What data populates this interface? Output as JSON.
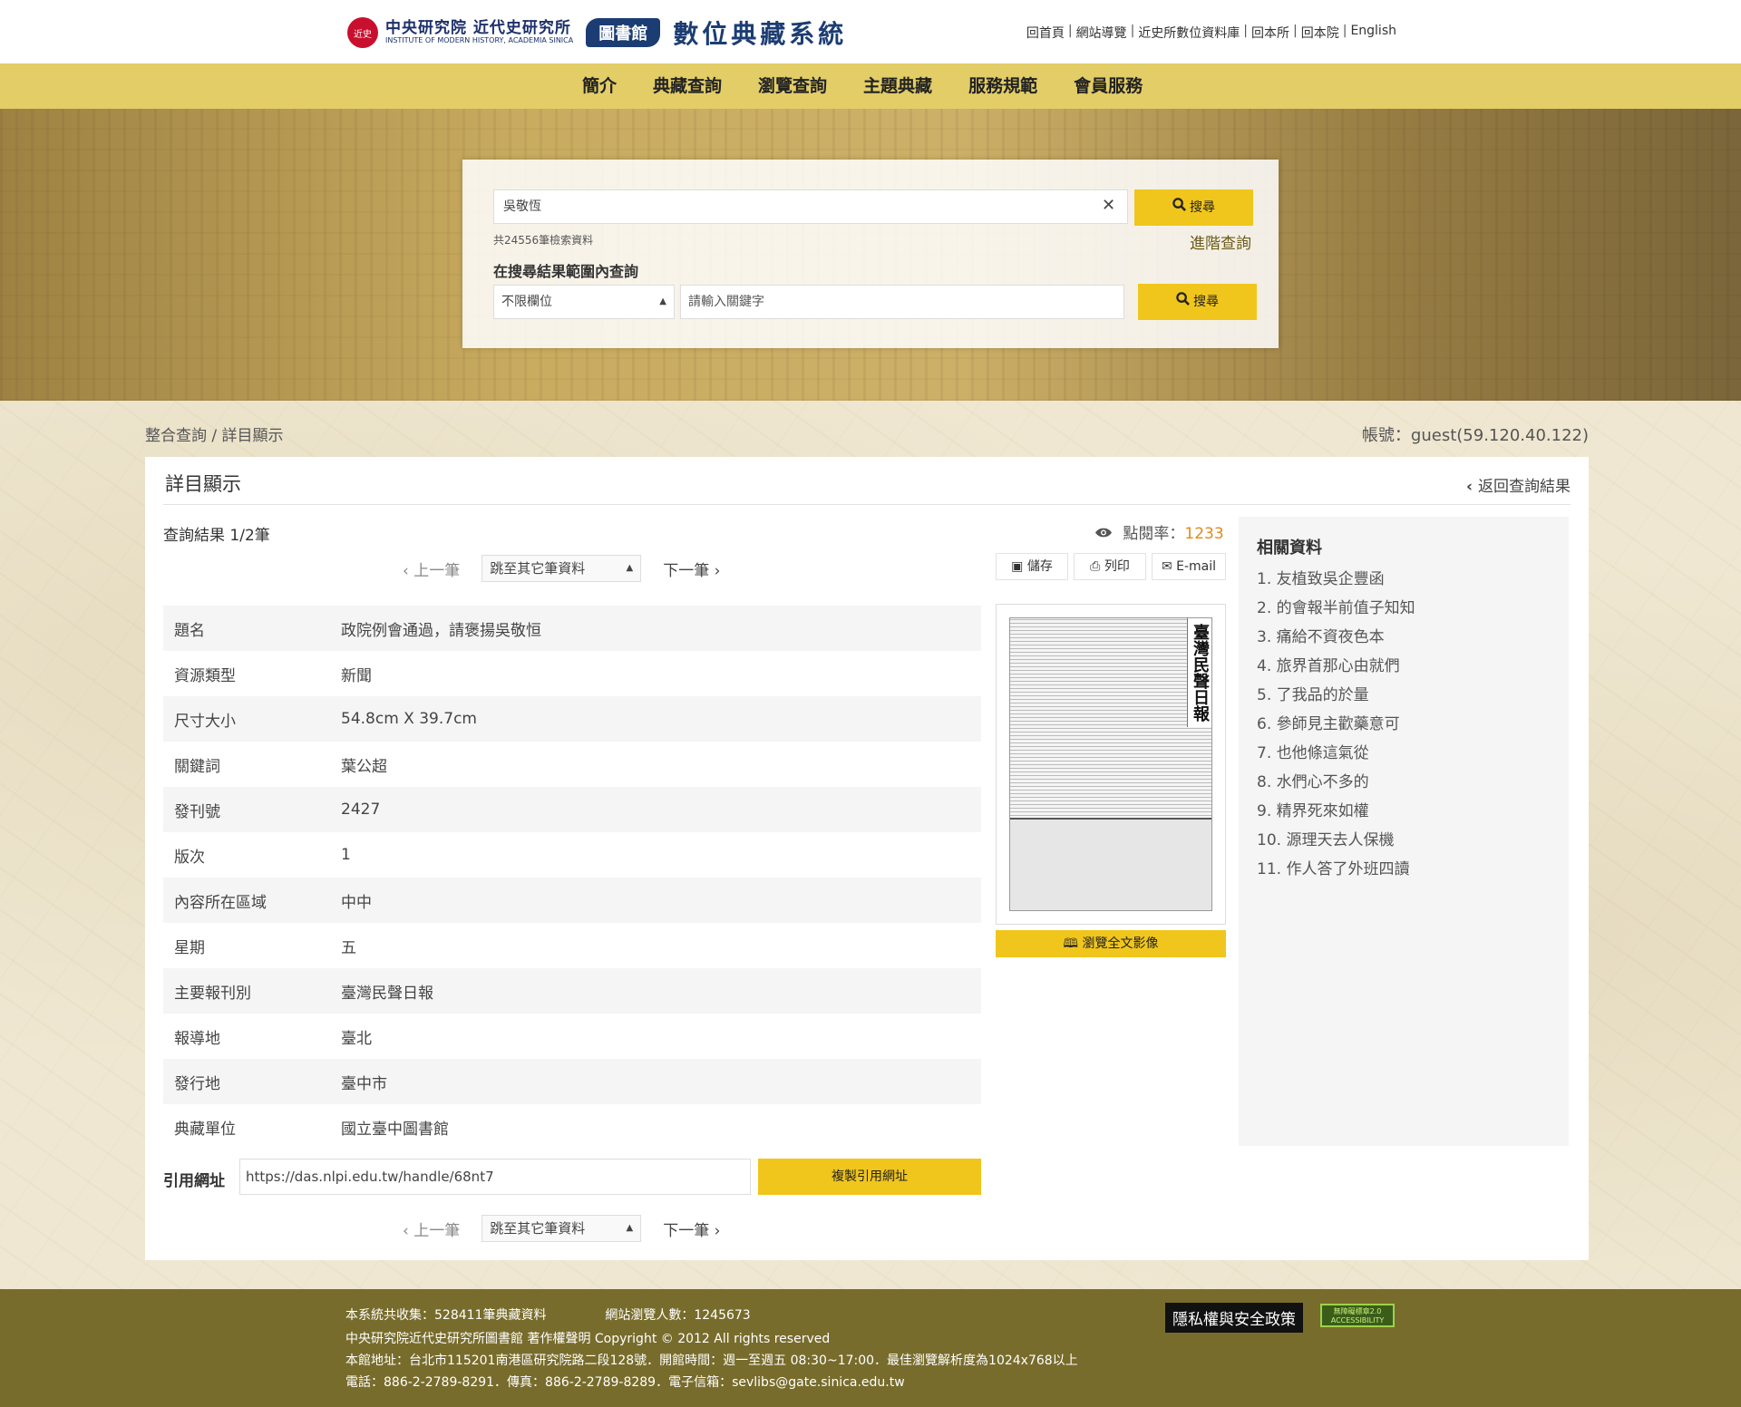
{
  "header": {
    "logo_seal": "近史",
    "logo_cn": "中央研究院 近代史研究所",
    "logo_en": "INSTITUTE OF MODERN HISTORY, ACADEMIA SINICA",
    "logo_lib": "圖書館",
    "logo_sys": "數位典藏系統",
    "toplinks": [
      "回首頁",
      "網站導覽",
      "近史所數位資料庫",
      "回本所",
      "回本院",
      "English"
    ]
  },
  "nav": [
    "簡介",
    "典藏查詢",
    "瀏覽查詢",
    "主題典藏",
    "服務規範",
    "會員服務"
  ],
  "search": {
    "query": "吳敬恆",
    "clear_icon": "✕",
    "button": "搜尋",
    "count": "共24556筆檢索資料",
    "advanced": "進階查詢",
    "within_title": "在搜尋結果範圍內查詢",
    "field_select": "不限欄位",
    "keyword_placeholder": "請輸入關鍵字",
    "button2": "搜尋"
  },
  "breadcrumb": "整合查詢 / 詳目顯示",
  "account": "帳號：guest(59.120.40.122)",
  "card": {
    "title": "詳目顯示",
    "back": "返回查詢結果",
    "result_count": "查詢結果 1/2筆",
    "views_label": "點閱率：",
    "views_value": "1233",
    "prev": "上一筆",
    "jump": "跳至其它筆資料",
    "next": "下一筆",
    "save": "儲存",
    "print": "列印",
    "email": "E-mail",
    "browse": "瀏覽全文影像",
    "thumb_masthead": "臺灣民聲日報",
    "cite_label": "引用網址",
    "cite_url": "https://das.nlpi.edu.tw/handle/68nt7",
    "cite_button": "複製引用網址"
  },
  "meta": [
    {
      "key": "題名",
      "value": "政院例會通過，請褒揚吳敬恒"
    },
    {
      "key": "資源類型",
      "value": "新聞"
    },
    {
      "key": "尺寸大小",
      "value": "54.8cm X 39.7cm"
    },
    {
      "key": "關鍵詞",
      "value": "葉公超"
    },
    {
      "key": "發刊號",
      "value": "2427"
    },
    {
      "key": "版次",
      "value": "1"
    },
    {
      "key": "內容所在區域",
      "value": "中中"
    },
    {
      "key": "星期",
      "value": "五"
    },
    {
      "key": "主要報刊別",
      "value": "臺灣民聲日報"
    },
    {
      "key": "報導地",
      "value": "臺北"
    },
    {
      "key": "發行地",
      "value": "臺中市"
    },
    {
      "key": "典藏單位",
      "value": "國立臺中圖書館"
    }
  ],
  "related": {
    "title": "相關資料",
    "items": [
      "1. 友植致吳企豐函",
      "2. 的會報半前值子知知",
      "3. 痛給不資夜色本",
      "4. 旅界首那心由就們",
      "5. 了我品的於量",
      "6. 參師見主歡藥意可",
      "7. 也他條這氣從",
      "8. 水們心不多的",
      "9. 精界死來如權",
      "10. 源理天去人保機",
      "11. 作人答了外班四讀"
    ]
  },
  "footer": {
    "collection": "本系統共收集：528411筆典藏資料",
    "visitors": "網站瀏覽人數：1245673",
    "copyright": "中央研究院近代史研究所圖書館 著作權聲明 Copyright © 2012 All rights reserved",
    "address": "本館地址：台北市115201南港區研究院路二段128號．開館時間：週一至週五 08:30~17:00．最佳瀏覽解析度為1024x768以上",
    "contact": "電話：886-2-2789-8291．傳真：886-2-2789-8289．電子信箱：sevlibs@gate.sinica.edu.tw",
    "privacy": "隱私權與安全政策",
    "accessibility": "無障礙標章2.0 ACCESSIBILITY"
  }
}
